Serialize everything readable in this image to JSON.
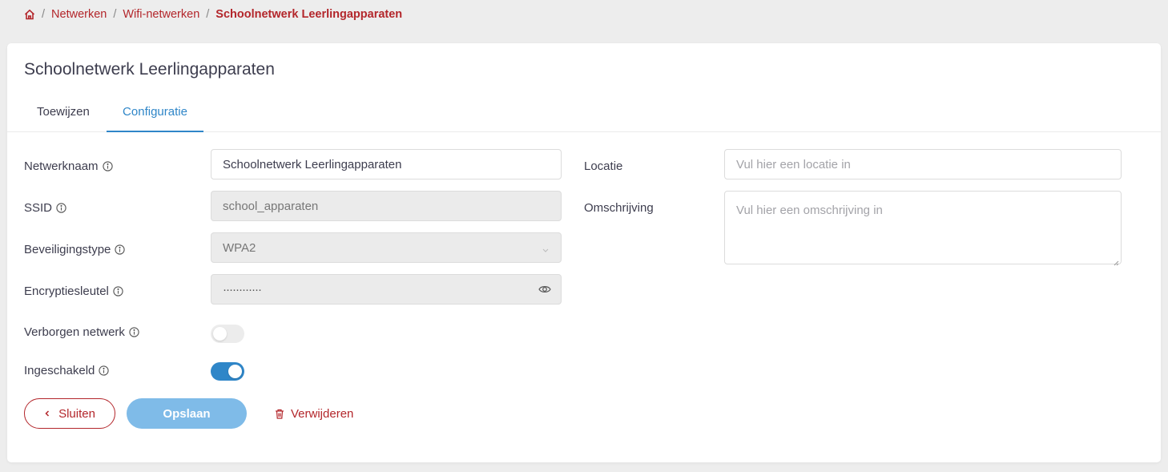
{
  "breadcrumb": {
    "home_icon": "home-icon",
    "items": [
      "Netwerken",
      "Wifi-netwerken"
    ],
    "current": "Schoolnetwerk Leerlingapparaten",
    "separator": "/"
  },
  "card": {
    "title": "Schoolnetwerk Leerlingapparaten",
    "tabs": [
      {
        "label": "Toewijzen",
        "active": false
      },
      {
        "label": "Configuratie",
        "active": true
      }
    ]
  },
  "form": {
    "network_name": {
      "label": "Netwerknaam",
      "value": "Schoolnetwerk Leerlingapparaten"
    },
    "ssid": {
      "label": "SSID",
      "value": "school_apparaten"
    },
    "security_type": {
      "label": "Beveiligingstype",
      "value": "WPA2"
    },
    "encryption_key": {
      "label": "Encryptiesleutel",
      "value": "············"
    },
    "hidden_network": {
      "label": "Verborgen netwerk",
      "on": false
    },
    "enabled": {
      "label": "Ingeschakeld",
      "on": true
    },
    "location": {
      "label": "Locatie",
      "placeholder": "Vul hier een locatie in"
    },
    "description": {
      "label": "Omschrijving",
      "placeholder": "Vul hier een omschrijving in"
    }
  },
  "actions": {
    "close_label": "Sluiten",
    "save_label": "Opslaan",
    "delete_label": "Verwijderen"
  },
  "colors": {
    "brand_red": "#b3262b",
    "accent_blue": "#2f86c8",
    "save_button_blue": "#7fbbe8"
  }
}
